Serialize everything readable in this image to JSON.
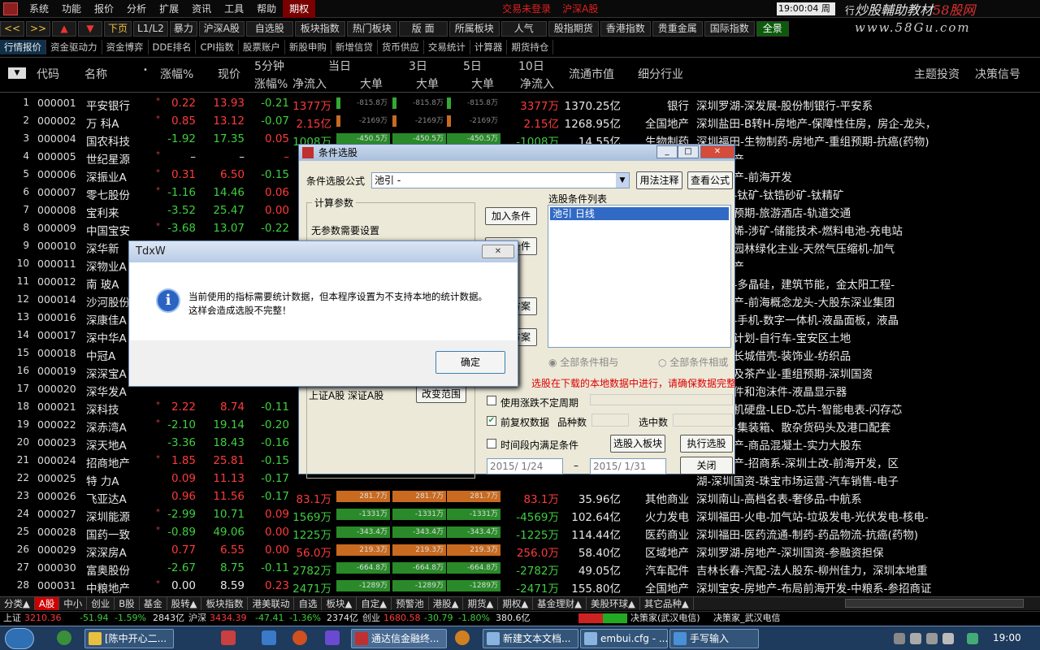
{
  "menu": {
    "items": [
      "系统",
      "功能",
      "报价",
      "分析",
      "扩展",
      "资讯",
      "工具",
      "帮助"
    ],
    "active": "期权",
    "alerts": [
      "交易未登录",
      "沪深A股"
    ],
    "clock": "19:00:04 周六",
    "extra": "行"
  },
  "watermark": {
    "line1_a": "炒股輔助教材",
    "line1_b": "58股网",
    "line2": "www.58Gu.com"
  },
  "toolbar": {
    "items": [
      "<<",
      ">>",
      "▲",
      "▼",
      "下页",
      "L1/L2",
      "暴力",
      "沪深A股",
      "自选股",
      "板块指数",
      "热门板块",
      "版 面",
      "所属板块",
      "人气",
      "股指期货",
      "香港指数",
      "贵重金属",
      "国际指数",
      "全景"
    ]
  },
  "subtabs": [
    "行情报价",
    "资金驱动力",
    "资金博弈",
    "DDE排名",
    "CPI指数",
    "股票账户",
    "新股申购",
    "新增信贷",
    "货币供应",
    "交易统计",
    "计算器",
    "期货持仓"
  ],
  "header": {
    "code": "代码",
    "name": "名称",
    "chg": "涨幅%",
    "price": "现价",
    "min5a": "5分钟",
    "min5b": "涨幅%",
    "cur": "当日",
    "net": "净流入",
    "big": "大单",
    "d3": "3日",
    "d5": "5日",
    "d10": "10日",
    "net10": "净流入",
    "mcap": "流通市值",
    "industry": "细分行业",
    "topic": "主题投资",
    "signal": "决策信号"
  },
  "rows": [
    {
      "idx": "1",
      "code": "000001",
      "name": "平安银行",
      "star": "*",
      "chg": "0.22",
      "price": "13.93",
      "chg5": "-0.21",
      "net": "1377万",
      "b1": "-815.8万",
      "b3": "-815.8万",
      "b5": "-815.8万",
      "net10": "3377万",
      "mcap": "1370.25亿",
      "ind": "银行",
      "topic": "深圳罗湖-深发展-股份制银行-平安系",
      "color": "red"
    },
    {
      "idx": "2",
      "code": "000002",
      "name": "万  科A",
      "star": "*",
      "chg": "0.85",
      "price": "13.12",
      "chg5": "-0.07",
      "net": "2.15亿",
      "b1": "-2169万",
      "b3": "-2169万",
      "b5": "-2169万",
      "net10": "2.15亿",
      "mcap": "1268.95亿",
      "ind": "全国地产",
      "topic": "深圳盐田-B转H-房地产-保障性住房，房企-龙头，",
      "color": "red"
    },
    {
      "idx": "3",
      "code": "000004",
      "name": "国农科技",
      "star": "",
      "chg": "-1.92",
      "price": "17.35",
      "chg5": "0.05",
      "net": "1008万",
      "b1": "-450.5万",
      "b3": "-450.5万",
      "b5": "-450.5万",
      "net10": "-1008万",
      "mcap": "14.55亿",
      "ind": "生物制药",
      "topic": "深圳福田-生物制药-房地产-重组预期-抗癌(药物)",
      "color": "grn"
    },
    {
      "idx": "4",
      "code": "000005",
      "name": "世纪星源",
      "star": "*",
      "chg": "–",
      "price": "–",
      "chg5": "–",
      "net": "",
      "b1": "",
      "b3": "",
      "b5": "",
      "net10": "",
      "mcap": "",
      "ind": "",
      "topic": "湖-房地产",
      "color": "wht"
    },
    {
      "idx": "5",
      "code": "000006",
      "name": "深振业A",
      "star": "*",
      "chg": "0.31",
      "price": "6.50",
      "chg5": "-0.15",
      "net": "",
      "b1": "",
      "b3": "",
      "b5": "",
      "net10": "",
      "mcap": "",
      "ind": "",
      "topic": "湖-房地产-前海开发",
      "color": "red"
    },
    {
      "idx": "6",
      "code": "000007",
      "name": "零七股份",
      "star": "*",
      "chg": "-1.16",
      "price": "14.46",
      "chg5": "0.06",
      "net": "",
      "b1": "",
      "b3": "",
      "b5": "",
      "net10": "",
      "mcap": "",
      "ind": "",
      "topic": "田-涉矿-钛矿-钛锆砂矿-钛精矿",
      "color": "grn"
    },
    {
      "idx": "7",
      "code": "000008",
      "name": "宝利来",
      "star": "",
      "chg": "-3.52",
      "price": "25.47",
      "chg5": "0.00",
      "net": "",
      "b1": "",
      "b3": "",
      "b5": "",
      "net10": "",
      "mcap": "",
      "ind": "",
      "topic": "山-重组预期-旅游酒店-轨道交通",
      "color": "grn"
    },
    {
      "idx": "8",
      "code": "000009",
      "name": "中国宝安",
      "star": "*",
      "chg": "-3.68",
      "price": "13.07",
      "chg5": "-0.22",
      "net": "",
      "b1": "",
      "b3": "",
      "b5": "",
      "net10": "",
      "mcap": "",
      "ind": "",
      "topic": "安-石墨烯-涉矿-储能技术-燃料电池-充电站",
      "color": "grn"
    },
    {
      "idx": "9",
      "code": "000010",
      "name": "深华新",
      "star": "",
      "chg": "",
      "price": "",
      "chg5": "",
      "net": "",
      "b1": "",
      "b3": "",
      "b5": "",
      "net10": "",
      "mcap": "",
      "ind": "",
      "topic": "东-转型园林绿化主业-天然气压缩机-加气",
      "color": "wht"
    },
    {
      "idx": "10",
      "code": "000011",
      "name": "深物业A",
      "star": "",
      "chg": "",
      "price": "",
      "chg5": "",
      "net": "",
      "b1": "",
      "b3": "",
      "b5": "",
      "net10": "",
      "mcap": "",
      "ind": "",
      "topic": "湖-房地产",
      "color": "wht"
    },
    {
      "idx": "11",
      "code": "000012",
      "name": "南  玻A",
      "star": "",
      "chg": "",
      "price": "",
      "chg5": "",
      "net": "",
      "b1": "",
      "b3": "",
      "b5": "",
      "net10": "",
      "mcap": "",
      "ind": "",
      "topic": "山-玻璃-多晶硅，建筑节能，金太阳工程-",
      "color": "wht"
    },
    {
      "idx": "12",
      "code": "000014",
      "name": "沙河股份",
      "star": "",
      "chg": "",
      "price": "",
      "chg5": "",
      "net": "",
      "b1": "",
      "b3": "",
      "b5": "",
      "net10": "",
      "mcap": "",
      "ind": "",
      "topic": "山-房地产-前海概念龙头-大股东深业集团",
      "color": "wht"
    },
    {
      "idx": "13",
      "code": "000016",
      "name": "深康佳A",
      "star": "",
      "chg": "",
      "price": "",
      "chg5": "",
      "net": "",
      "b1": "",
      "b3": "",
      "b5": "",
      "net10": "",
      "mcap": "",
      "ind": "",
      "topic": "山-家电-手机-数字一体机-液晶面板，液晶",
      "color": "wht"
    },
    {
      "idx": "14",
      "code": "000017",
      "name": "深中华A",
      "star": "",
      "chg": "",
      "price": "",
      "chg5": "",
      "net": "",
      "b1": "",
      "b3": "",
      "b5": "",
      "net10": "",
      "mcap": "",
      "ind": "",
      "topic": "田-重整计划-自行车-宝安区土地",
      "color": "wht"
    },
    {
      "idx": "15",
      "code": "000018",
      "name": "中冠A",
      "star": "",
      "chg": "",
      "price": "",
      "chg5": "",
      "net": "",
      "b1": "",
      "b3": "",
      "b5": "",
      "net10": "",
      "mcap": "",
      "ind": "",
      "topic": "山-神州长城借壳-装饰业-纺织品",
      "color": "wht"
    },
    {
      "idx": "16",
      "code": "000019",
      "name": "深深宝A",
      "star": "",
      "chg": "",
      "price": "",
      "chg5": "",
      "net": "",
      "b1": "",
      "b3": "",
      "b5": "",
      "net10": "",
      "mcap": "",
      "ind": "",
      "topic": "田-果汁及茶产业-重组预期-深圳国资",
      "color": "wht"
    },
    {
      "idx": "17",
      "code": "000020",
      "name": "深华发A",
      "star": "",
      "chg": "",
      "price": "",
      "chg5": "",
      "net": "",
      "b1": "",
      "b3": "",
      "b5": "",
      "net10": "",
      "mcap": "",
      "ind": "",
      "topic": "田-注塑件和泡沫件-液晶显示器",
      "color": "wht"
    },
    {
      "idx": "18",
      "code": "000021",
      "name": "深科技",
      "star": "*",
      "chg": "2.22",
      "price": "8.74",
      "chg5": "-0.11",
      "net": "",
      "b1": "",
      "b3": "",
      "b5": "",
      "net10": "",
      "mcap": "",
      "ind": "",
      "topic": "田-计算机硬盘-LED-芯片-智能电表-闪存芯",
      "color": "red"
    },
    {
      "idx": "19",
      "code": "000022",
      "name": "深赤湾A",
      "star": "*",
      "chg": "-2.10",
      "price": "19.14",
      "chg5": "-0.20",
      "net": "",
      "b1": "",
      "b3": "",
      "b5": "",
      "net10": "",
      "mcap": "",
      "ind": "",
      "topic": "山-港口-集装箱、散杂货码头及港口配套",
      "color": "grn"
    },
    {
      "idx": "20",
      "code": "000023",
      "name": "深天地A",
      "star": "",
      "chg": "-3.36",
      "price": "18.43",
      "chg5": "-0.16",
      "net": "",
      "b1": "",
      "b3": "",
      "b5": "",
      "net10": "",
      "mcap": "",
      "ind": "",
      "topic": "田-房地产-商品混凝土-实力大股东",
      "color": "grn"
    },
    {
      "idx": "21",
      "code": "000024",
      "name": "招商地产",
      "star": "*",
      "chg": "1.85",
      "price": "25.81",
      "chg5": "-0.15",
      "net": "",
      "b1": "",
      "b3": "",
      "b5": "",
      "net10": "",
      "mcap": "",
      "ind": "",
      "topic": "山-房地产-招商系-深圳土改-前海开发，区",
      "color": "red"
    },
    {
      "idx": "22",
      "code": "000025",
      "name": "特  力A",
      "star": "",
      "chg": "0.09",
      "price": "11.13",
      "chg5": "-0.17",
      "net": "",
      "b1": "",
      "b3": "",
      "b5": "",
      "net10": "",
      "mcap": "",
      "ind": "",
      "topic": "湖-深圳国资-珠宝市场运营-汽车销售-电子",
      "color": "red"
    },
    {
      "idx": "23",
      "code": "000026",
      "name": "飞亚达A",
      "star": "",
      "chg": "0.96",
      "price": "11.56",
      "chg5": "-0.17",
      "net": "83.1万",
      "b1": "281.7万",
      "b3": "281.7万",
      "b5": "281.7万",
      "net10": "83.1万",
      "mcap": "35.96亿",
      "ind": "其他商业",
      "topic": "深圳南山-高档名表-奢侈品-中航系",
      "color": "red"
    },
    {
      "idx": "24",
      "code": "000027",
      "name": "深圳能源",
      "star": "*",
      "chg": "-2.99",
      "price": "10.71",
      "chg5": "0.09",
      "net": "1569万",
      "b1": "-1331万",
      "b3": "-1331万",
      "b5": "-1331万",
      "net10": "-4569万",
      "mcap": "102.64亿",
      "ind": "火力发电",
      "topic": "深圳福田-火电-加气站-垃圾发电-光伏发电-核电-",
      "color": "grn"
    },
    {
      "idx": "25",
      "code": "000028",
      "name": "国药一致",
      "star": "*",
      "chg": "-0.89",
      "price": "49.06",
      "chg5": "0.00",
      "net": "1225万",
      "b1": "-343.4万",
      "b3": "-343.4万",
      "b5": "-343.4万",
      "net10": "-1225万",
      "mcap": "114.44亿",
      "ind": "医药商业",
      "topic": "深圳福田-医药流通-制药-药品物流-抗癌(药物)",
      "color": "grn"
    },
    {
      "idx": "26",
      "code": "000029",
      "name": "深深房A",
      "star": "",
      "chg": "0.77",
      "price": "6.55",
      "chg5": "0.00",
      "net": "56.0万",
      "b1": "219.3万",
      "b3": "219.3万",
      "b5": "219.3万",
      "net10": "256.0万",
      "mcap": "58.40亿",
      "ind": "区域地产",
      "topic": "深圳罗湖-房地产-深圳国资-参融资担保",
      "color": "red"
    },
    {
      "idx": "27",
      "code": "000030",
      "name": "富奥股份",
      "star": "",
      "chg": "-2.67",
      "price": "8.75",
      "chg5": "-0.11",
      "net": "2782万",
      "b1": "-664.8万",
      "b3": "-664.8万",
      "b5": "-664.8万",
      "net10": "-2782万",
      "mcap": "49.05亿",
      "ind": "汽车配件",
      "topic": "吉林长春-汽配-法人股东-柳州佳力，深圳本地重",
      "color": "grn"
    },
    {
      "idx": "28",
      "code": "000031",
      "name": "中粮地产",
      "star": "*",
      "chg": "0.00",
      "price": "8.59",
      "chg5": "0.23",
      "net": "2471万",
      "b1": "-1289万",
      "b3": "-1289万",
      "b5": "-1289万",
      "net10": "-2471万",
      "mcap": "155.80亿",
      "ind": "全国地产",
      "topic": "深圳宝安-房地产-布局前海开发-中粮系-参招商证",
      "color": "wht"
    }
  ],
  "categories": [
    "分类▲",
    "A股",
    "中小",
    "创业",
    "B股",
    "基金",
    "股转▲",
    "板块指数",
    "港美联动",
    "自选",
    "板块▲",
    "自定▲",
    "预警池",
    "港股▲",
    "期货▲",
    "期权▲",
    "基金理财▲",
    "美股环球▲",
    "其它品种▲"
  ],
  "status": {
    "sh_label": "上证",
    "sh": "3210.36",
    "sh_chg": "-51.94",
    "sh_pct": "-1.59%",
    "sh_vol": "2843亿",
    "sz_label": "沪深",
    "sz": "3434.39",
    "sz_chg": "-47.41",
    "sz_pct": "-1.36%",
    "sz_vol": "2374亿",
    "cy_label": "创业",
    "cy": "1680.58",
    "cy_chg": "-30.79",
    "cy_pct": "-1.80%",
    "cy_vol": "380.6亿",
    "src1": "决策家(武汉电信)",
    "src2": "决策家_武汉电信"
  },
  "taskbar": {
    "tasks": [
      "[陈中开心二...",
      "通达信金融终...",
      "新建文本文档...",
      "embui.cfg - ...",
      "手写输入"
    ],
    "time": "19:00"
  },
  "dialog_cond": {
    "title": "条件选股",
    "formula_label": "条件选股公式",
    "formula_value": "池引      -",
    "usage_btn": "用法注释",
    "view_btn": "查看公式",
    "param_title": "计算参数",
    "param_text": "无参数需要设置",
    "add_btn": "加入条件",
    "del_btn": "删除条件",
    "save_btn": "保存方案",
    "load_btn": "引入方案",
    "list_title": "选股条件列表",
    "list_item": "池引  日线",
    "radio_all": "全部条件相与",
    "radio_any": "全部条件相或",
    "range_text": "上证A股 深证A股",
    "range_btn": "改变范围",
    "warn": "选股在下载的本地数据中进行，请确保数据完整",
    "opt1": "使用涨跌不定周期",
    "opt2": "前复权数据",
    "count_label": "品种数",
    "selected_label": "选中数",
    "opt3": "时间段内满足条件",
    "to_block_btn": "选股入板块",
    "run_btn": "执行选股",
    "date_from": "2015/ 1/24",
    "date_sep": "–",
    "date_to": "2015/ 1/31",
    "close_btn": "关闭"
  },
  "dialog_msg": {
    "title": "TdxW",
    "message": "当前使用的指标需要统计数据，但本程序设置为不支持本地的统计数据。这样会造成选股不完整！",
    "ok": "确定"
  }
}
